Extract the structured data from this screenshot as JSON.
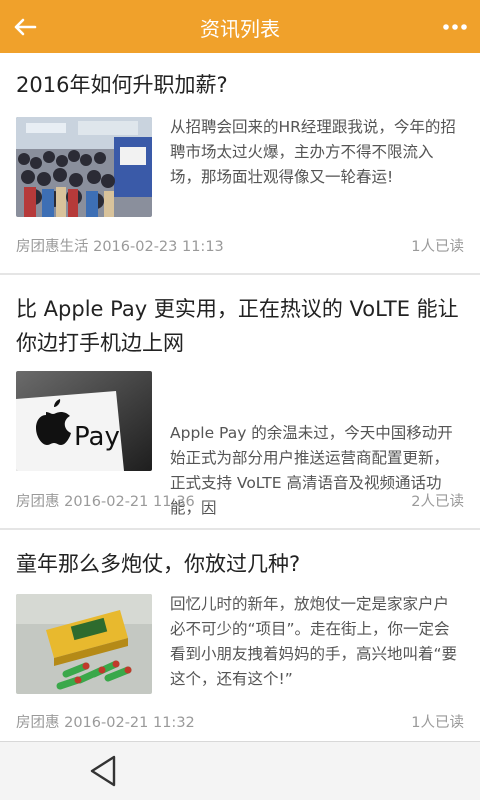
{
  "appbar": {
    "title": "资讯列表",
    "back_icon": "arrow-left-icon",
    "more_icon": "more-horizontal-icon",
    "accent_color": "#f0a12b"
  },
  "articles": [
    {
      "title": "2016年如何升职加薪?",
      "summary": "从招聘会回来的HR经理跟我说，今年的招聘市场太过火爆，主办方不得不限流入场，那场面壮观得像又一轮春运!",
      "meta": "房团惠生活 2016-02-23 11:13",
      "reads": "1人已读"
    },
    {
      "title": "比 Apple Pay 更实用，正在热议的 VoLTE 能让你边打手机边上网",
      "summary": "Apple Pay 的余温未过，今天中国移动开始正式为部分用户推送运营商配置更新，正式支持 VoLTE 高清语音及视频通话功能，因",
      "meta": "房团惠 2016-02-21 11:36",
      "reads": "2人已读",
      "thumb_text": "Pay"
    },
    {
      "title": "童年那么多炮仗，你放过几种?",
      "summary": "回忆儿时的新年，放炮仗一定是家家户户必不可少的“项目”。走在街上，你一定会看到小朋友拽着妈妈的手，高兴地叫着“要这个，还有这个!”",
      "meta": "房团惠 2016-02-21 11:32",
      "reads": "1人已读"
    }
  ],
  "navbar": {
    "back_icon": "triangle-back-icon"
  }
}
